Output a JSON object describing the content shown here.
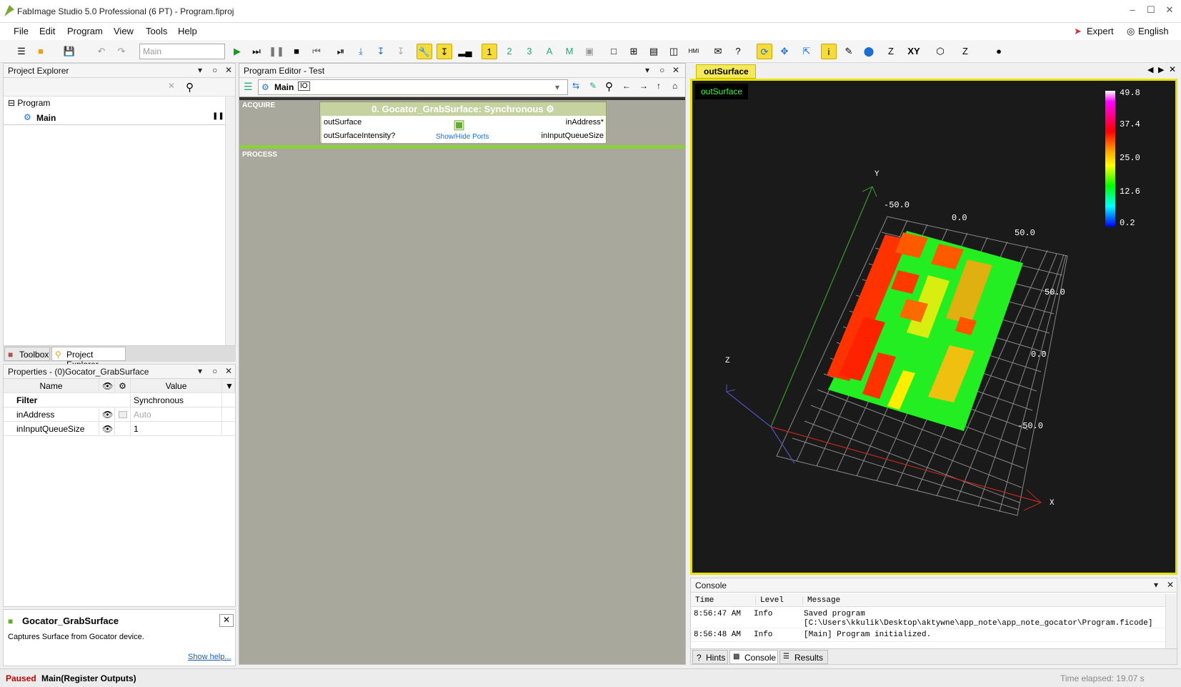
{
  "window": {
    "title": "FabImage Studio 5.0 Professional (6 PT) - Program.fiproj",
    "minimize": "–",
    "maximize": "☐",
    "close": "✕"
  },
  "menu": {
    "items": [
      "File",
      "Edit",
      "Program",
      "View",
      "Tools",
      "Help"
    ],
    "mode_label": "Expert",
    "language_label": "English"
  },
  "toolbar": {
    "macro_combo": "Main",
    "z_label": "Z",
    "xy_label": "XY",
    "z2_label": "Z"
  },
  "project_explorer": {
    "title": "Project Explorer",
    "root": "Program",
    "item": "Main"
  },
  "bottom_tabs": {
    "toolbox": "Toolbox",
    "project_explorer": "Project Explorer"
  },
  "properties": {
    "title": "Properties - (0)Gocator_GrabSurface",
    "col_name": "Name",
    "col_value": "Value",
    "filter_label": "Filter",
    "filter_value": "Synchronous",
    "rows": [
      {
        "name": "inAddress",
        "value": "Auto"
      },
      {
        "name": "inInputQueueSize",
        "value": "1"
      }
    ]
  },
  "help": {
    "title": "Gocator_GrabSurface",
    "description": "Captures Surface from Gocator device.",
    "link": "Show help..."
  },
  "program_editor": {
    "title": "Program Editor - Test",
    "macro": "Main",
    "io": "IO",
    "section_acquire": "ACQUIRE",
    "section_process": "PROCESS",
    "block": {
      "title": "0. Gocator_GrabSurface: Synchronous",
      "outputs": [
        "outSurface",
        "outSurfaceIntensity?"
      ],
      "inputs": [
        "inAddress*",
        "inInputQueueSize"
      ],
      "show_hide": "Show/Hide Ports"
    }
  },
  "viewer": {
    "tab": "outSurface",
    "label": "outSurface",
    "colorbar": {
      "ticks": [
        "49.8",
        "37.4",
        "25.0",
        "12.6",
        "0.2"
      ]
    },
    "axes": {
      "x": "X",
      "y": "Y",
      "z": "Z"
    },
    "ticks": {
      "top": [
        "-50.0",
        "0.0",
        "50.0"
      ],
      "right": [
        "50.0",
        "0.0",
        "-50.0"
      ]
    }
  },
  "console": {
    "title": "Console",
    "col_time": "Time",
    "col_level": "Level",
    "col_message": "Message",
    "rows": [
      {
        "time": "8:56:47 AM",
        "level": "Info",
        "message": "Saved program",
        "message2": "[C:\\Users\\kkulik\\Desktop\\aktywne\\app_note\\app_note_gocator\\Program.ficode]"
      },
      {
        "time": "8:56:48 AM",
        "level": "Info",
        "message": "[Main] Program initialized.",
        "message2": ""
      }
    ],
    "tabs": [
      "Hints",
      "Console",
      "Results"
    ]
  },
  "status": {
    "state": "Paused",
    "context": "Main(Register Outputs)",
    "elapsed": "Time elapsed: 19.07 s"
  },
  "colors": {
    "accent_yellow": "#f5dc3a",
    "board_green": "#22ee22",
    "viewer_bg": "#1a1a1a",
    "paused_red": "#c00000"
  }
}
